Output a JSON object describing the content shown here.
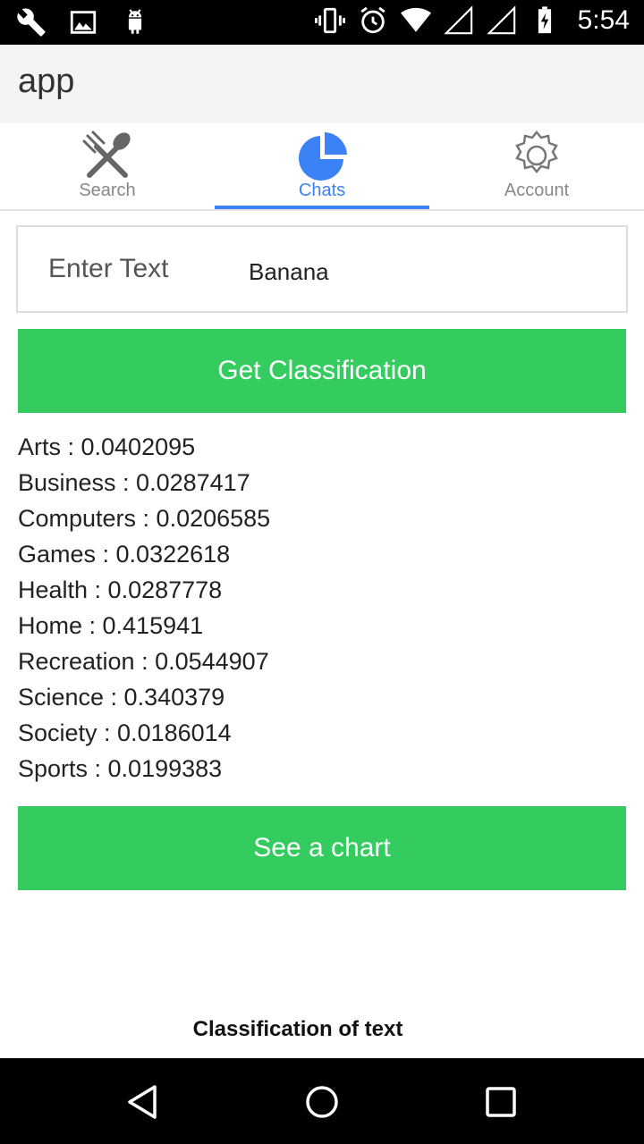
{
  "status_bar": {
    "time": "5:54",
    "left_icons": [
      "wrench-icon",
      "image-icon",
      "android-icon"
    ],
    "right_icons": [
      "vibrate-icon",
      "alarm-icon",
      "wifi-icon",
      "signal-icon",
      "signal-icon",
      "battery-icon"
    ]
  },
  "app_bar": {
    "title": "app"
  },
  "tabs": [
    {
      "label": "Search",
      "icon": "fork-spoon-icon",
      "active": false
    },
    {
      "label": "Chats",
      "icon": "pie-chart-icon",
      "active": true
    },
    {
      "label": "Account",
      "icon": "gear-icon",
      "active": false
    }
  ],
  "entry": {
    "label": "Enter Text",
    "value": "Banana"
  },
  "buttons": {
    "classify": "Get Classification",
    "chart": "See a chart"
  },
  "results": [
    "Arts : 0.0402095",
    "Business : 0.0287417",
    "Computers : 0.0206585",
    "Games : 0.0322618",
    "Health : 0.0287778",
    "Home : 0.415941",
    "Recreation : 0.0544907",
    "Science : 0.340379",
    "Society : 0.0186014",
    "Sports : 0.0199383"
  ],
  "chart_caption": "Classification of text",
  "colors": {
    "accent": "#3b82f6",
    "button": "#34cc5f",
    "button_text": "#ffffff"
  }
}
